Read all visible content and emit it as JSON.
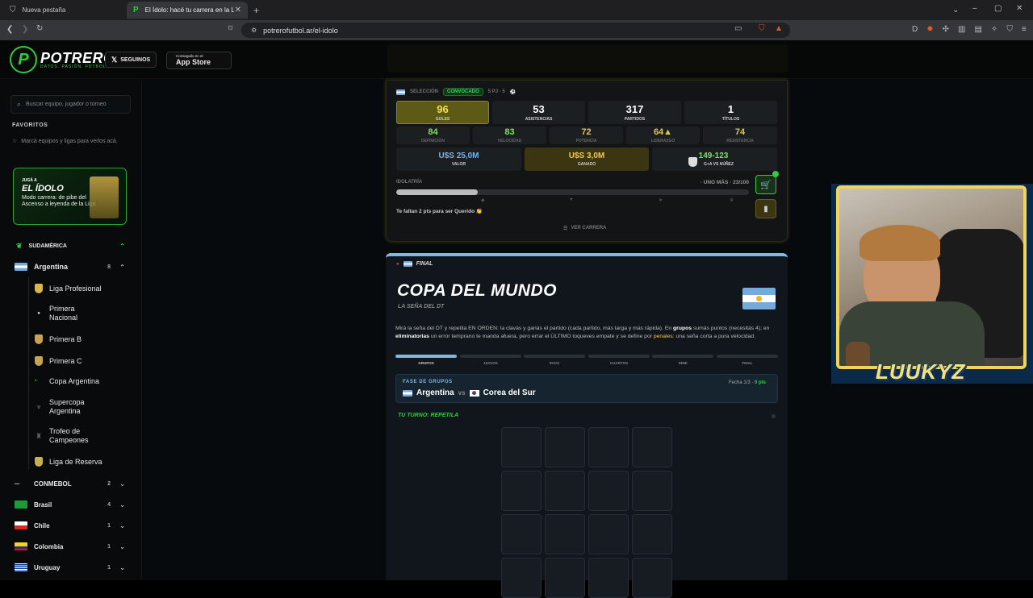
{
  "browser": {
    "tabs": [
      {
        "title": "Nueva pestaña"
      },
      {
        "title": "El Ídolo: hacé tu carrera en la Lig"
      }
    ],
    "url": "potrerofutbol.ar/el-idolo"
  },
  "header": {
    "logo_letter": "P",
    "logo": "POTRERO",
    "tagline": "DATOS. PASIÓN. FÚTBOL.",
    "follow_label": "SEGUINOS",
    "appstore_small": "Conseguilo en el",
    "appstore_label": "App Store"
  },
  "sidebar": {
    "search_placeholder": "Buscar equipo, jugador o torneo",
    "favorites_title": "FAVORITOS",
    "favorites_hint": "Marcá equipos y ligas para verlos acá.",
    "promo": {
      "kicker": "JUGÁ A",
      "title": "EL ÍDOLO",
      "desc": "Modo carrera: de pibe del Ascenso a leyenda de la Liga"
    },
    "region": "SUDAMÉRICA",
    "argentina": {
      "label": "Argentina",
      "count": "8"
    },
    "leagues": [
      "Liga Profesional",
      "Primera Nacional",
      "Primera B",
      "Primera C",
      "Copa Argentina",
      "Supercopa Argentina",
      "Trofeo de Campeones",
      "Liga de Reserva"
    ],
    "countries": [
      {
        "label": "CONMEBOL",
        "count": "2"
      },
      {
        "label": "Brasil",
        "count": "4"
      },
      {
        "label": "Chile",
        "count": "1"
      },
      {
        "label": "Colombia",
        "count": "1"
      },
      {
        "label": "Uruguay",
        "count": "1"
      }
    ]
  },
  "player": {
    "seleccion": "SELECCIÓN",
    "status": "CONVOCADO",
    "pj": "5 PJ · 5",
    "stats": [
      {
        "value": "96",
        "label": "GOLES"
      },
      {
        "value": "53",
        "label": "ASISTENCIAS"
      },
      {
        "value": "317",
        "label": "PARTIDOS"
      },
      {
        "value": "1",
        "label": "TÍTULOS"
      }
    ],
    "attrs": [
      {
        "value": "84",
        "label": "DEFINICIÓN"
      },
      {
        "value": "83",
        "label": "VELOCIDAD"
      },
      {
        "value": "72",
        "label": "POTENCIA"
      },
      {
        "value": "64▲",
        "label": "LIDERAZGO"
      },
      {
        "value": "74",
        "label": "RESISTENCIA"
      }
    ],
    "valor": {
      "value": "U$S 25,0M",
      "label": "VALOR"
    },
    "ganado": {
      "value": "U$S 3,0M",
      "label": "GANADO"
    },
    "versus": {
      "value": "149-123",
      "label": "G+A VS NÚÑEZ"
    },
    "idolatria_label": "IDOLATRÍA",
    "idolatria_right": "· UNO MÁS · 23/100",
    "idolatria_progress": 0.23,
    "faltan": "Te faltan 2 pts para ser Querido 👏",
    "ver_carrera": "VER CARRERA"
  },
  "game": {
    "stage": "FINAL",
    "title": "COPA DEL MUNDO",
    "subtitle": "LA SEÑA DEL DT",
    "rules_pre": "Mirá la seña del DT y repetila EN ORDEN: la clavás y ganás el partido (cada partido, más larga y más rápida). En ",
    "rules_grupos": "grupos",
    "rules_mid": " sumás puntos (necesitás 4); en ",
    "rules_elim": "eliminatorias",
    "rules_mid2": " un error temprano te manda afuera, pero errar el ÚLTIMO toqueves empate y se define por ",
    "rules_pen": "penales",
    "rules_post": ": una seña corta a pura velocidad.",
    "steps": [
      "GRUPOS",
      "16AVOS",
      "8VOS",
      "CUARTOS",
      "SEMI",
      "FINAL"
    ],
    "phase": "FASE DE GRUPOS",
    "team1": "Argentina",
    "vs": "vs",
    "team2": "Corea del Sur",
    "fecha": "Fecha 1/3 · ",
    "pts": "0 pts",
    "turn": "TU TURNO: REPETILA"
  },
  "stream": {
    "name": "LUUKYZ"
  },
  "colors": {
    "accent": "#2ecc40",
    "gold": "#f2c94c",
    "blue": "#7fb8e3"
  }
}
